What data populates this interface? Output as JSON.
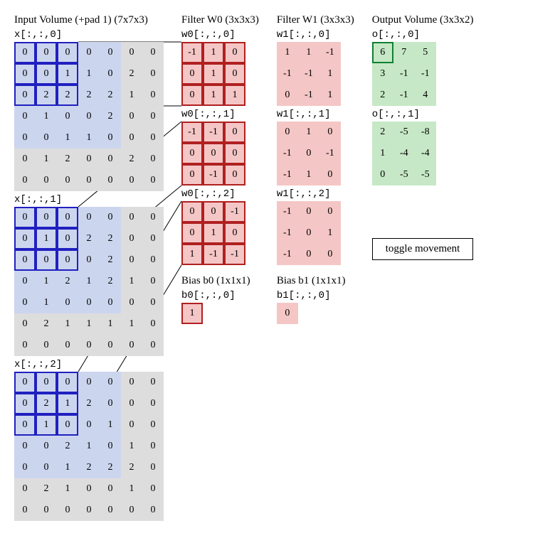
{
  "input": {
    "title": "Input Volume (+pad 1) (7x7x3)",
    "receptive": {
      "r0": 0,
      "c0": 0,
      "size": 3
    },
    "slices": [
      {
        "label": "x[:,:,0]",
        "grid": [
          [
            0,
            0,
            0,
            0,
            0,
            0,
            0
          ],
          [
            0,
            0,
            1,
            1,
            0,
            2,
            0
          ],
          [
            0,
            2,
            2,
            2,
            2,
            1,
            0
          ],
          [
            0,
            1,
            0,
            0,
            2,
            0,
            0
          ],
          [
            0,
            0,
            1,
            1,
            0,
            0,
            0
          ],
          [
            0,
            1,
            2,
            0,
            0,
            2,
            0
          ],
          [
            0,
            0,
            0,
            0,
            0,
            0,
            0
          ]
        ]
      },
      {
        "label": "x[:,:,1]",
        "grid": [
          [
            0,
            0,
            0,
            0,
            0,
            0,
            0
          ],
          [
            0,
            1,
            0,
            2,
            2,
            0,
            0
          ],
          [
            0,
            0,
            0,
            0,
            2,
            0,
            0
          ],
          [
            0,
            1,
            2,
            1,
            2,
            1,
            0
          ],
          [
            0,
            1,
            0,
            0,
            0,
            0,
            0
          ],
          [
            0,
            2,
            1,
            1,
            1,
            1,
            0
          ],
          [
            0,
            0,
            0,
            0,
            0,
            0,
            0
          ]
        ]
      },
      {
        "label": "x[:,:,2]",
        "grid": [
          [
            0,
            0,
            0,
            0,
            0,
            0,
            0
          ],
          [
            0,
            2,
            1,
            2,
            0,
            0,
            0
          ],
          [
            0,
            1,
            0,
            0,
            1,
            0,
            0
          ],
          [
            0,
            0,
            2,
            1,
            0,
            1,
            0
          ],
          [
            0,
            0,
            1,
            2,
            2,
            2,
            0
          ],
          [
            0,
            2,
            1,
            0,
            0,
            1,
            0
          ],
          [
            0,
            0,
            0,
            0,
            0,
            0,
            0
          ]
        ]
      }
    ]
  },
  "filter0": {
    "title": "Filter W0 (3x3x3)",
    "slices": [
      {
        "label": "w0[:,:,0]",
        "grid": [
          [
            -1,
            1,
            0
          ],
          [
            0,
            1,
            0
          ],
          [
            0,
            1,
            1
          ]
        ]
      },
      {
        "label": "w0[:,:,1]",
        "grid": [
          [
            -1,
            -1,
            0
          ],
          [
            0,
            0,
            0
          ],
          [
            0,
            -1,
            0
          ]
        ]
      },
      {
        "label": "w0[:,:,2]",
        "grid": [
          [
            0,
            0,
            -1
          ],
          [
            0,
            1,
            0
          ],
          [
            1,
            -1,
            -1
          ]
        ]
      }
    ],
    "bias_title": "Bias b0 (1x1x1)",
    "bias_label": "b0[:,:,0]",
    "bias": 1
  },
  "filter1": {
    "title": "Filter W1 (3x3x3)",
    "slices": [
      {
        "label": "w1[:,:,0]",
        "grid": [
          [
            1,
            1,
            -1
          ],
          [
            -1,
            -1,
            1
          ],
          [
            0,
            -1,
            1
          ]
        ]
      },
      {
        "label": "w1[:,:,1]",
        "grid": [
          [
            0,
            1,
            0
          ],
          [
            -1,
            0,
            -1
          ],
          [
            -1,
            1,
            0
          ]
        ]
      },
      {
        "label": "w1[:,:,2]",
        "grid": [
          [
            -1,
            0,
            0
          ],
          [
            -1,
            0,
            1
          ],
          [
            -1,
            0,
            0
          ]
        ]
      }
    ],
    "bias_title": "Bias b1 (1x1x1)",
    "bias_label": "b1[:,:,0]",
    "bias": 0
  },
  "output": {
    "title": "Output Volume (3x3x2)",
    "active": {
      "slice": 0,
      "r": 0,
      "c": 0
    },
    "slices": [
      {
        "label": "o[:,:,0]",
        "grid": [
          [
            6,
            7,
            5
          ],
          [
            3,
            -1,
            -1
          ],
          [
            2,
            -1,
            4
          ]
        ]
      },
      {
        "label": "o[:,:,1]",
        "grid": [
          [
            2,
            -5,
            -8
          ],
          [
            1,
            -4,
            -4
          ],
          [
            0,
            -5,
            -5
          ]
        ]
      }
    ]
  },
  "button": {
    "label": "toggle movement"
  },
  "colors": {
    "inputBorder": "#2020c0",
    "filterBorder": "#b02020",
    "output": "#c6e8c6",
    "outputBorder": "#108030"
  }
}
